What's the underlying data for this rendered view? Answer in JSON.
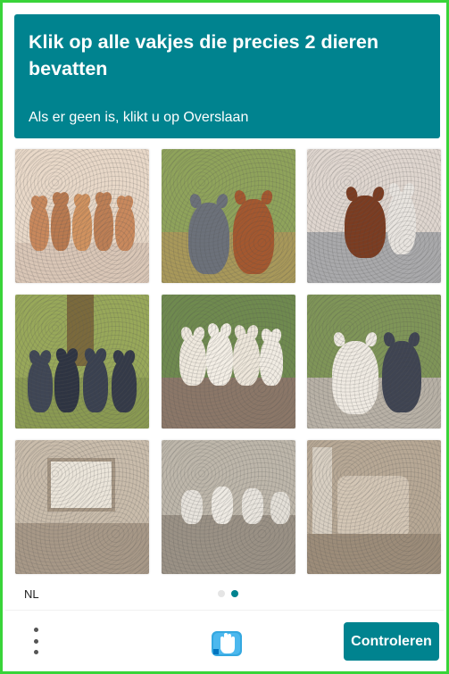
{
  "challenge": {
    "title": "Klik op alle vakjes die precies 2 dieren bevatten",
    "subtitle": "Als er geen is, klikt u op Overslaan"
  },
  "tiles": [
    {
      "name": "tile-1",
      "animal_count_visible": 5,
      "scene": "row of puppies"
    },
    {
      "name": "tile-2",
      "animal_count_visible": 2,
      "scene": "two puppies in garden"
    },
    {
      "name": "tile-3",
      "animal_count_visible": 2,
      "scene": "two puppies on sofa"
    },
    {
      "name": "tile-4",
      "animal_count_visible": 4,
      "scene": "dark puppies in garden"
    },
    {
      "name": "tile-5",
      "animal_count_visible": 4,
      "scene": "white puppies on sofa"
    },
    {
      "name": "tile-6",
      "animal_count_visible": 2,
      "scene": "white and dark puppy"
    },
    {
      "name": "tile-7",
      "animal_count_visible": 0,
      "scene": "empty room with window"
    },
    {
      "name": "tile-8",
      "animal_count_visible": 0,
      "scene": "couch with cushions"
    },
    {
      "name": "tile-9",
      "animal_count_visible": 0,
      "scene": "empty armchair room"
    }
  ],
  "footer": {
    "language": "NL",
    "submit_label": "Controleren",
    "pagination": {
      "total": 2,
      "current": 2
    }
  },
  "colors": {
    "accent": "#00838f",
    "frame": "#39d439"
  },
  "icons": {
    "menu": "vertical-dots-icon",
    "logo": "hcaptcha-hand-logo"
  }
}
